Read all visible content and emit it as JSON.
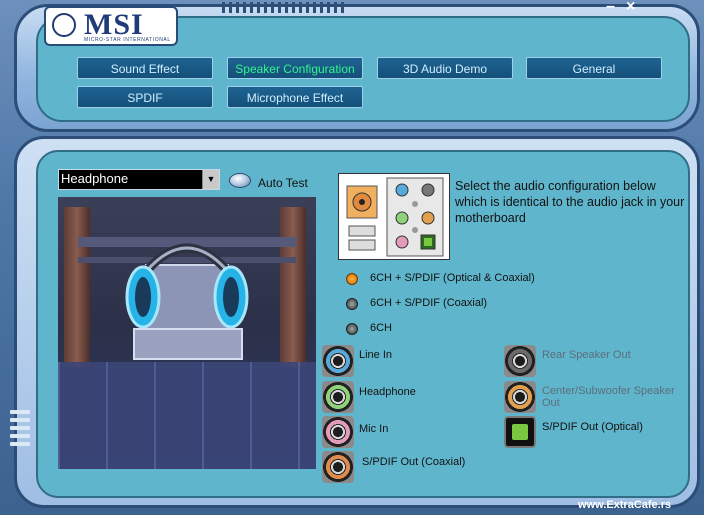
{
  "app": {
    "logo_text": "MSI",
    "logo_subtitle": "MICRO-STAR INTERNATIONAL",
    "minimize": "–",
    "close": "×"
  },
  "tabs": [
    {
      "label": "Sound Effect",
      "active": false
    },
    {
      "label": "Speaker Configuration",
      "active": true
    },
    {
      "label": "3D Audio Demo",
      "active": false
    },
    {
      "label": "General",
      "active": false
    },
    {
      "label": "SPDIF",
      "active": false
    },
    {
      "label": "Microphone Effect",
      "active": false
    }
  ],
  "speaker_select": {
    "value": "Headphone"
  },
  "auto_test": {
    "label": "Auto Test"
  },
  "diagram_text": "Select the audio configuration below which is identical to the audio jack in your motherboard",
  "options": [
    {
      "label": "6CH + S/PDIF (Optical & Coaxial)",
      "selected": true
    },
    {
      "label": "6CH + S/PDIF (Coaxial)",
      "selected": false
    },
    {
      "label": "6CH",
      "selected": false
    }
  ],
  "jacks_left": [
    {
      "label": "Line In",
      "color": "#57a9d9",
      "icon": "line-in-jack-icon"
    },
    {
      "label": "Headphone",
      "color": "#8fd27a",
      "icon": "headphone-jack-icon"
    },
    {
      "label": "Mic In",
      "color": "#e39abb",
      "icon": "mic-in-jack-icon"
    },
    {
      "label": "S/PDIF Out (Coaxial)",
      "color": "#e08b4e",
      "icon": "spdif-coaxial-jack-icon"
    }
  ],
  "jacks_right": [
    {
      "label": "Rear Speaker Out",
      "color": "#6b6b6b",
      "icon": "rear-speaker-jack-icon",
      "dim": true
    },
    {
      "label": "Center/Subwoofer Speaker Out",
      "color": "#e0a050",
      "icon": "center-subwoofer-jack-icon",
      "dim": true
    },
    {
      "label": "S/PDIF Out (Optical)",
      "color": "#78c840",
      "icon": "spdif-optical-jack-icon",
      "dim": false
    }
  ],
  "watermark": "www.ExtraCafe.rs"
}
